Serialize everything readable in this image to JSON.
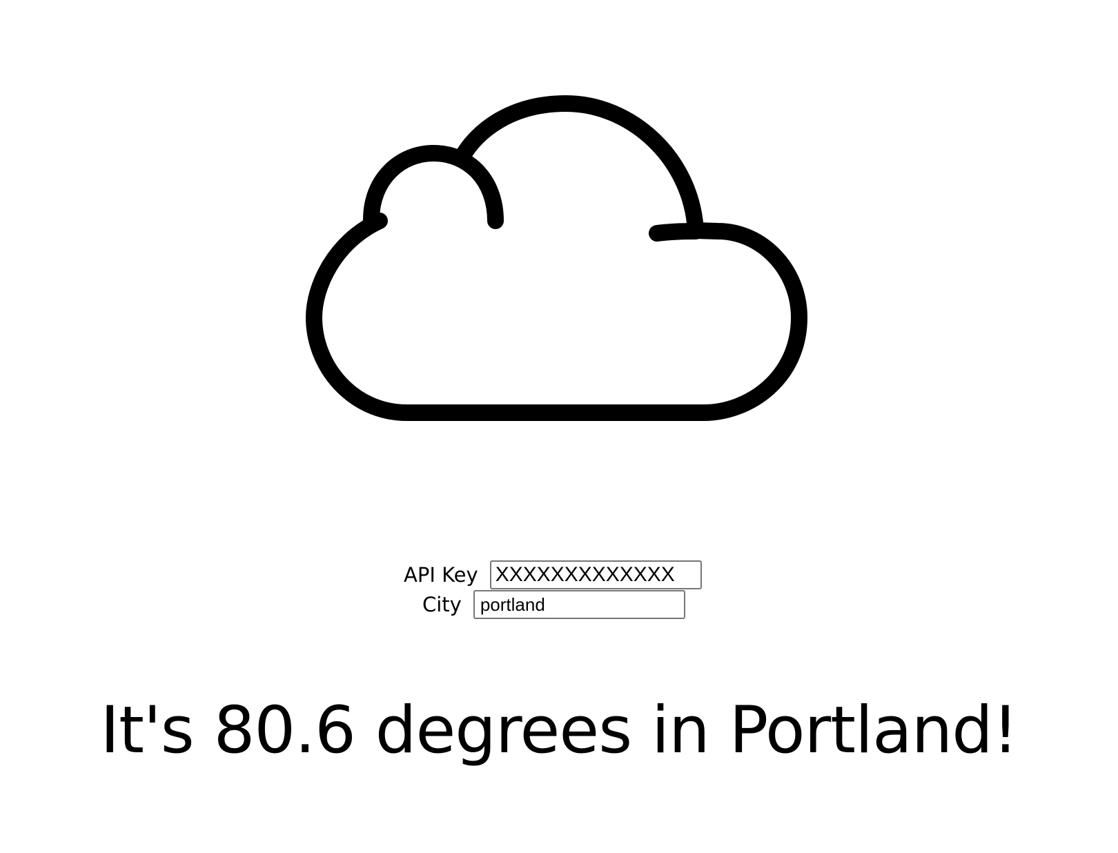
{
  "weather": {
    "icon": "cloud-icon",
    "message": "It's 80.6 degrees in Portland!"
  },
  "form": {
    "api_key": {
      "label": "API Key",
      "value": "XXXXXXXXXXXXX"
    },
    "city": {
      "label": "City",
      "value": "portland"
    }
  },
  "colors": {
    "icon_stroke": "#000000",
    "background": "#ffffff",
    "input_border": "#767676"
  }
}
